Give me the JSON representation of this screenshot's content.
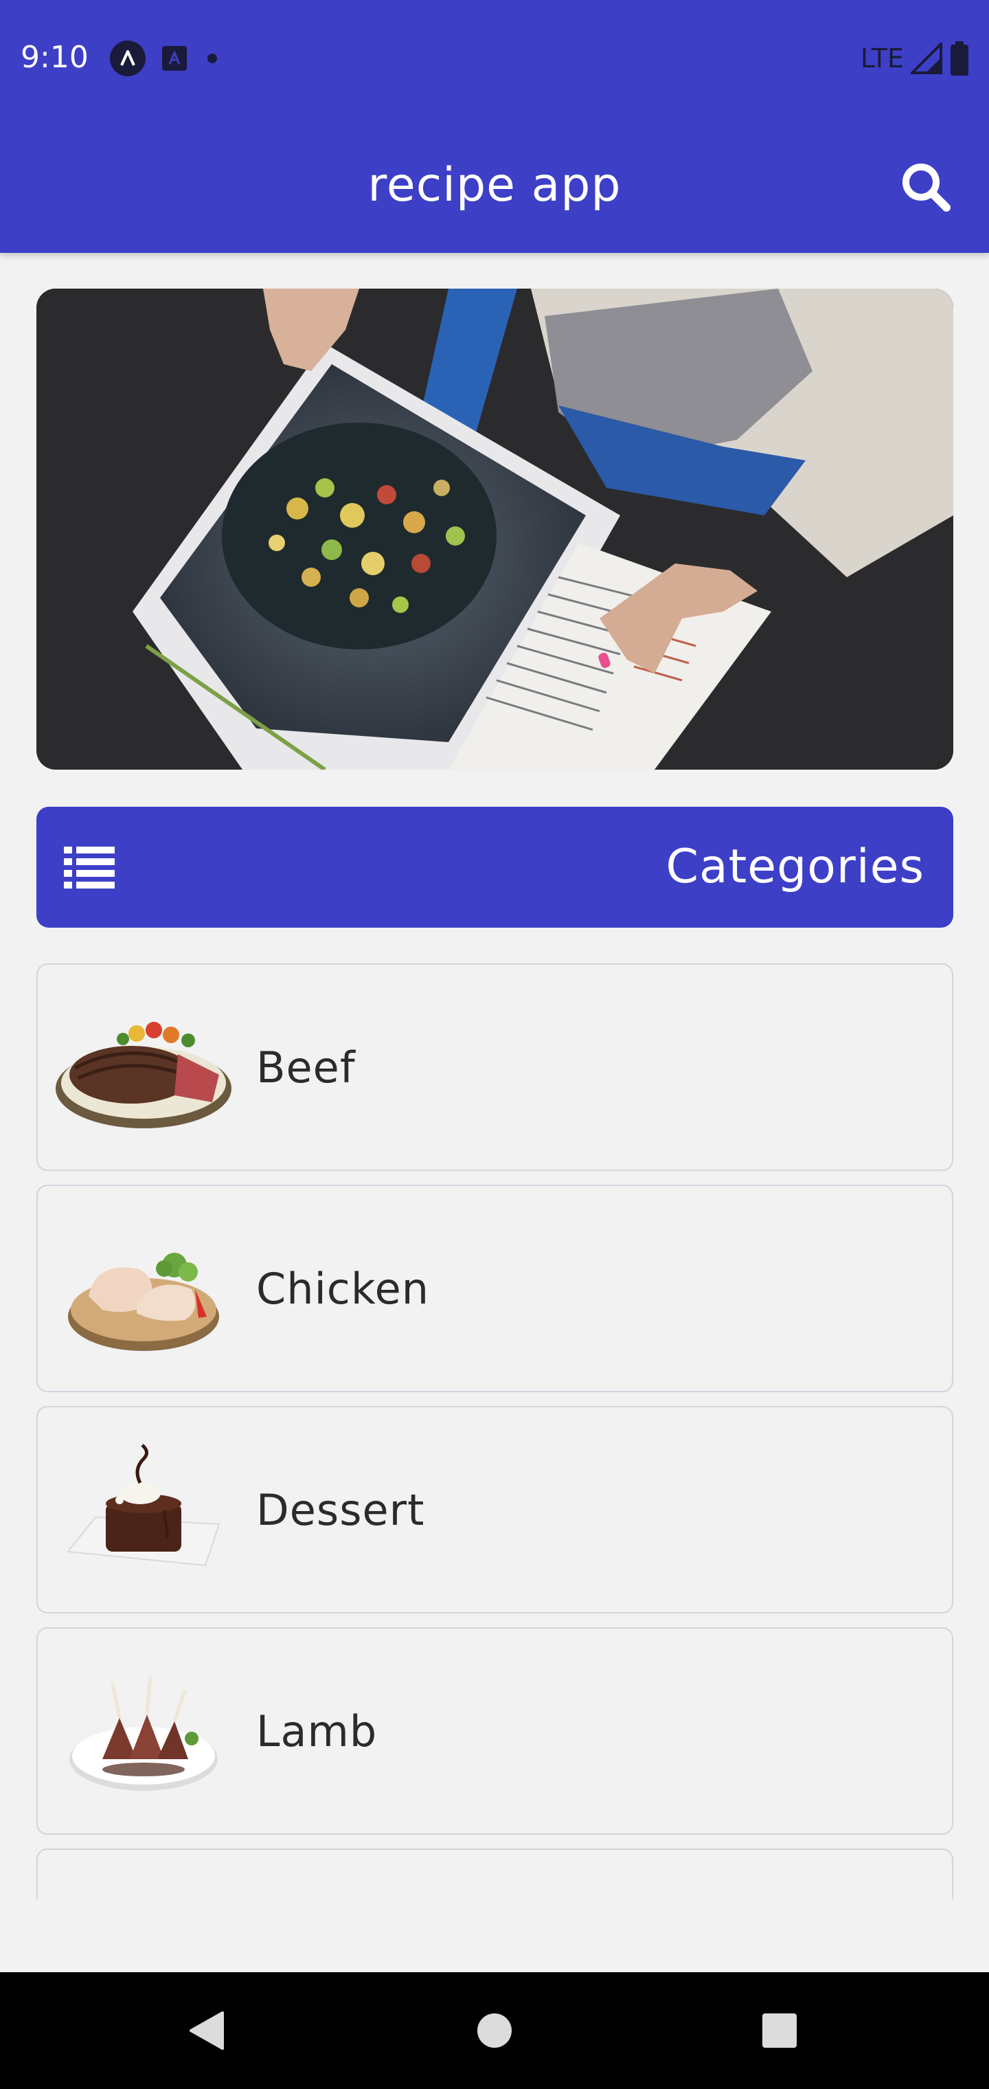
{
  "status_bar": {
    "time": "9:10",
    "network": "LTE",
    "icons": [
      "app-a-icon",
      "app-square-a-icon",
      "notification-dot-icon",
      "signal-icon",
      "battery-icon"
    ]
  },
  "app_bar": {
    "title": "recipe app",
    "search_icon": "search-icon"
  },
  "hero": {
    "image": "hero-cookbook-image"
  },
  "categories": {
    "title": "Categories",
    "icon": "list-icon",
    "items": [
      {
        "label": "Beef",
        "image": "beef-image"
      },
      {
        "label": "Chicken",
        "image": "chicken-image"
      },
      {
        "label": "Dessert",
        "image": "dessert-image"
      },
      {
        "label": "Lamb",
        "image": "lamb-image"
      },
      {
        "label": "",
        "image": ""
      }
    ]
  },
  "nav_bar": {
    "buttons": [
      "back-icon",
      "home-icon",
      "recents-icon"
    ]
  },
  "colors": {
    "primary": "#3d3fc7",
    "background": "#f2f2f2",
    "card_border": "#d2d5de",
    "text": "#2b2b2b"
  }
}
